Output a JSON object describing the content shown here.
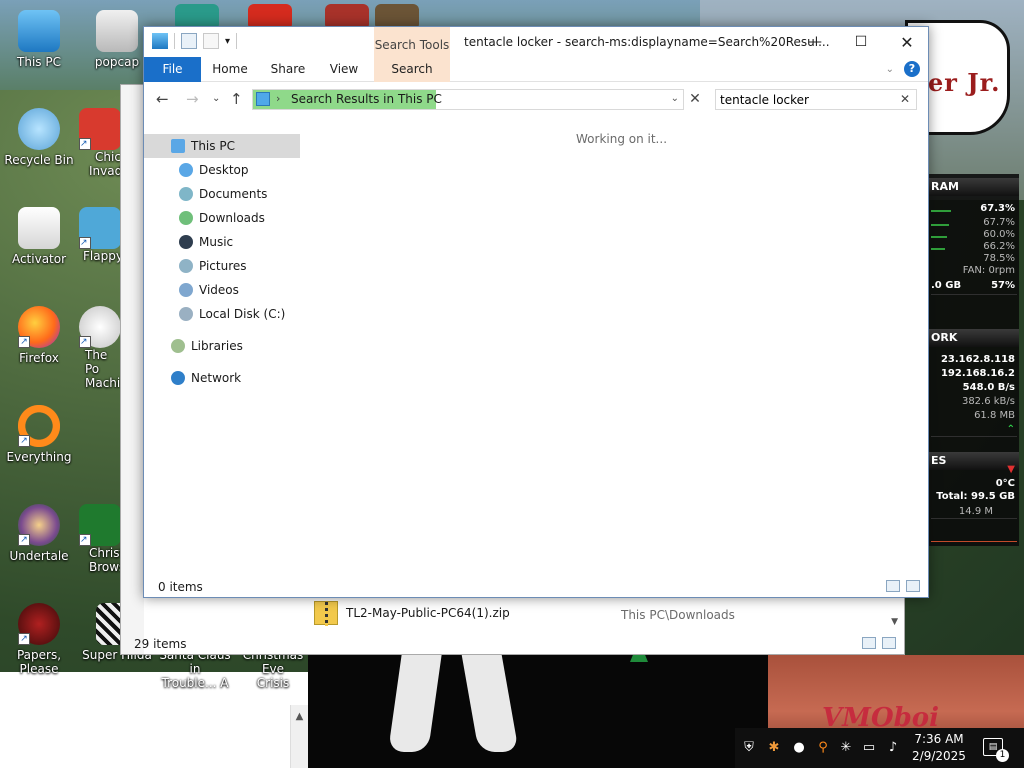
{
  "desktop": {
    "icons": [
      {
        "label": "This PC"
      },
      {
        "label": "popcap"
      },
      {
        "label": "Recycle Bin"
      },
      {
        "label": "Chic"
      },
      {
        "label": "Invad"
      },
      {
        "label": "Activator"
      },
      {
        "label": "Flappy"
      },
      {
        "label": "Firefox"
      },
      {
        "label": "The Po"
      },
      {
        "label": "Machi"
      },
      {
        "label": "Everything"
      },
      {
        "label": "Undertale"
      },
      {
        "label": "Christ"
      },
      {
        "label": "Brows"
      },
      {
        "label": "Papers, Please"
      },
      {
        "label": "Super Hilda"
      },
      {
        "label": "Santa Claus in"
      },
      {
        "label": "Trouble... A"
      },
      {
        "label": "Christmas Eve"
      },
      {
        "label": "Crisis"
      }
    ],
    "speech_text": "er Jr.",
    "watermark": "VMOboi"
  },
  "explorer": {
    "title": "tentacle locker - search-ms:displayname=Search%20Resul...",
    "search_tools_label": "Search Tools",
    "ribbon_tabs": [
      "File",
      "Home",
      "Share",
      "View",
      "Search"
    ],
    "address": "Search Results in This PC",
    "search_value": "tentacle locker",
    "working_text": "Working on it...",
    "nav_items": [
      {
        "label": "This PC",
        "color": "#5aa7e6"
      },
      {
        "label": "Desktop",
        "color": "#5aa7e6"
      },
      {
        "label": "Documents",
        "color": "#7fb6c8"
      },
      {
        "label": "Downloads",
        "color": "#6fbf7a"
      },
      {
        "label": "Music",
        "color": "#2f3e4f"
      },
      {
        "label": "Pictures",
        "color": "#8fb3c6"
      },
      {
        "label": "Videos",
        "color": "#7fa7cf"
      },
      {
        "label": "Local Disk (C:)",
        "color": "#9ab0c2"
      },
      {
        "label": "Libraries",
        "color": "#9fbf8f"
      },
      {
        "label": "Network",
        "color": "#2f7fc9"
      }
    ],
    "status": "0 items",
    "accent": "#1a6fc9"
  },
  "back_window": {
    "file_name": "TL2-May-Public-PC64(1).zip",
    "file_path": "This PC\\Downloads",
    "status": "29 items"
  },
  "gadget": {
    "ram_header": "RAM",
    "ram_values": [
      "67.3%",
      "67.7%",
      "60.0%",
      "66.2%",
      "78.5%"
    ],
    "fan": "FAN: 0rpm",
    "mem_total": ".0 GB",
    "mem_pct": "57%",
    "network_header": "ORK",
    "ip_public": "23.162.8.118",
    "ip_local": "192.168.16.2",
    "speed_down": "548.0 B/s",
    "speed_up": "382.6 kB/s",
    "transfer": "61.8 MB",
    "drives_header": "ES",
    "temp": "0°C",
    "total": "Total: 99.5 GB",
    "used": "14.9 M"
  },
  "tray": {
    "time": "7:36 AM",
    "date": "2/9/2025",
    "notifications": "1"
  }
}
